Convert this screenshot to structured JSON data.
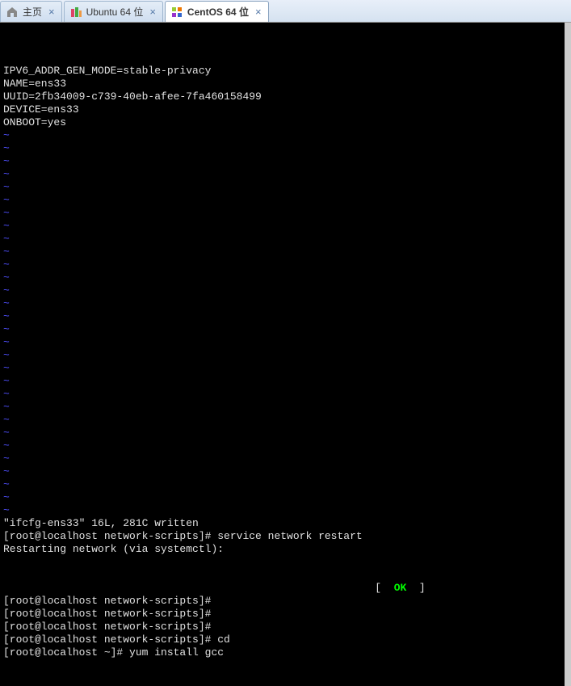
{
  "tabs": [
    {
      "label": "主页",
      "icon": "home-icon"
    },
    {
      "label": "Ubuntu 64 位",
      "icon": "ubuntu-icon"
    },
    {
      "label": "CentOS 64 位",
      "icon": "centos-icon",
      "active": true
    }
  ],
  "terminal": {
    "config_lines": [
      "IPV6_ADDR_GEN_MODE=stable-privacy",
      "NAME=ens33",
      "UUID=2fb34009-c739-40eb-afee-7fa460158499",
      "DEVICE=ens33",
      "ONBOOT=yes"
    ],
    "tilde": "~",
    "tilde_count": 30,
    "status_line": "\"ifcfg-ens33\" 16L, 281C written",
    "prompt1": "[root@localhost network-scripts]#",
    "prompt_home": "[root@localhost ~]#",
    "cmd_service": "service network restart",
    "restarting": "Restarting network (via systemctl):",
    "ok_left": "[",
    "ok_text": "OK",
    "ok_right": "]",
    "cmd_cd": "cd",
    "cmd_yum": "yum install gcc"
  }
}
